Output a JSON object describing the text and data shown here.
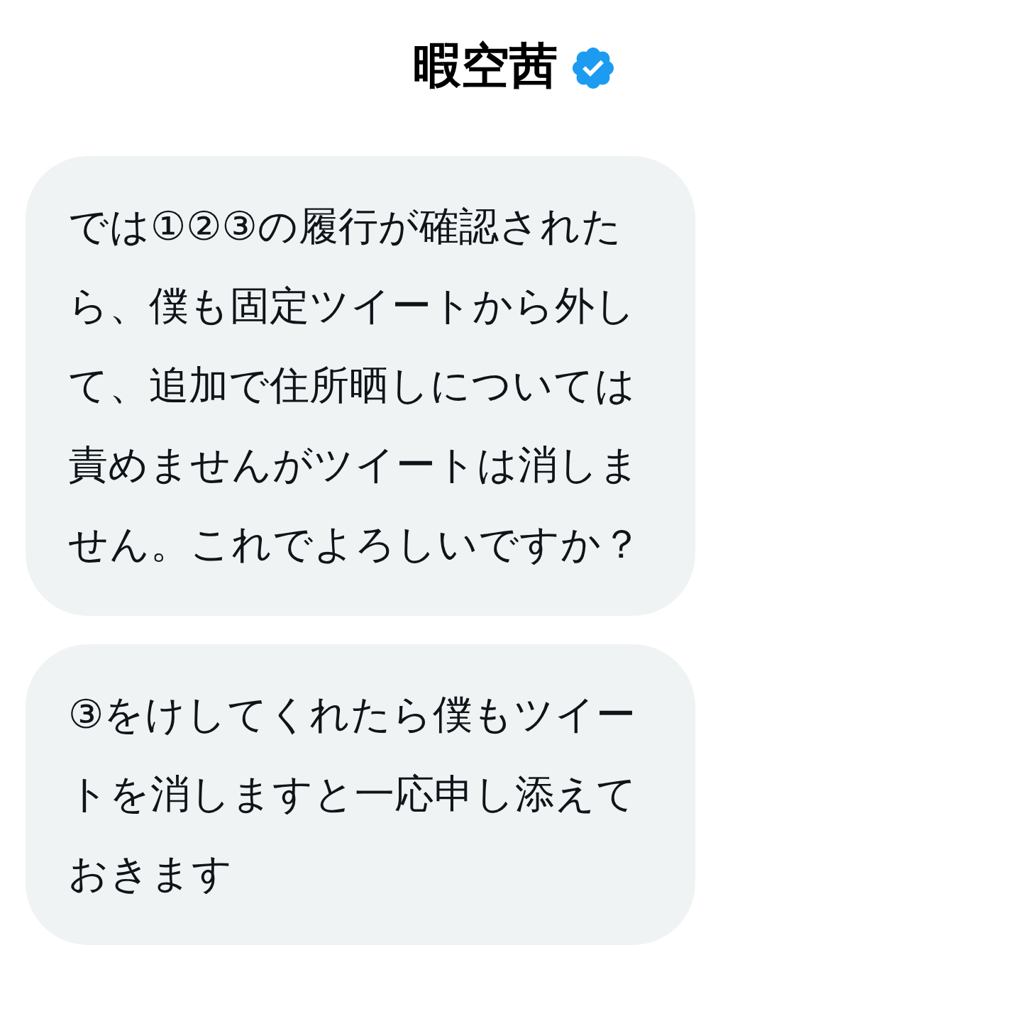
{
  "header": {
    "name": "暇空茜",
    "verified": true
  },
  "messages": [
    {
      "text": "では①②③の履行が確認されたら、僕も固定ツイートから外して、追加で住所晒しについては責めませんがツイートは消しません。これでよろしいですか？"
    },
    {
      "text": "③をけしてくれたら僕もツイートを消しますと一応申し添えておきます"
    }
  ]
}
